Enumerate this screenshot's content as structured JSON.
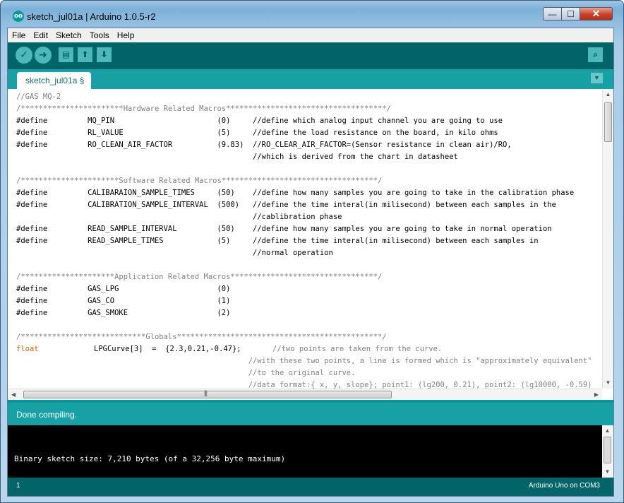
{
  "window": {
    "title": "sketch_jul01a | Arduino 1.0.5-r2",
    "controls": {
      "minimize": "—",
      "maximize": "☐",
      "close": "✕"
    },
    "icon_glyph": "oo"
  },
  "menu": [
    "File",
    "Edit",
    "Sketch",
    "Tools",
    "Help"
  ],
  "toolbar": {
    "verify_icon": "✓",
    "upload_icon": "➜",
    "new_icon": "▤",
    "open_icon": "⬆",
    "save_icon": "⬇",
    "serial_monitor_icon": "⌕"
  },
  "tabs": {
    "active": "sketch_jul01a §",
    "menu_icon": "▼"
  },
  "code_lines": [
    {
      "text": "//GAS MQ-2",
      "cls": "c-comment"
    },
    {
      "text": "/***********************Hardware Related Macros************************************/",
      "cls": "c-comment"
    },
    {
      "text": "#define         MQ_PIN                       (0)     //define which analog input channel you are going to use",
      "cls": "c-code"
    },
    {
      "text": "#define         RL_VALUE                     (5)     //define the load resistance on the board, in kilo ohms",
      "cls": "c-code"
    },
    {
      "text": "#define         RO_CLEAN_AIR_FACTOR          (9.83)  //RO_CLEAR_AIR_FACTOR=(Sensor resistance in clean air)/RO,",
      "cls": "c-code"
    },
    {
      "text": "                                                     //which is derived from the chart in datasheet",
      "cls": "c-code"
    },
    {
      "text": "",
      "cls": "c-code"
    },
    {
      "text": "/**********************Software Related Macros***********************************/",
      "cls": "c-comment"
    },
    {
      "text": "#define         CALIBARAION_SAMPLE_TIMES     (50)    //define how many samples you are going to take in the calibration phase",
      "cls": "c-code"
    },
    {
      "text": "#define         CALIBRATION_SAMPLE_INTERVAL  (500)   //define the time interal(in milisecond) between each samples in the",
      "cls": "c-code"
    },
    {
      "text": "                                                     //cablibration phase",
      "cls": "c-code"
    },
    {
      "text": "#define         READ_SAMPLE_INTERVAL         (50)    //define how many samples you are going to take in normal operation",
      "cls": "c-code"
    },
    {
      "text": "#define         READ_SAMPLE_TIMES            (5)     //define the time interal(in milisecond) between each samples in",
      "cls": "c-code"
    },
    {
      "text": "                                                     //normal operation",
      "cls": "c-code"
    },
    {
      "text": "",
      "cls": "c-code"
    },
    {
      "text": "/*********************Application Related Macros*********************************/",
      "cls": "c-comment"
    },
    {
      "text": "#define         GAS_LPG                      (0)",
      "cls": "c-code"
    },
    {
      "text": "#define         GAS_CO                       (1)",
      "cls": "c-code"
    },
    {
      "text": "#define         GAS_SMOKE                    (2)",
      "cls": "c-code"
    },
    {
      "text": "",
      "cls": "c-code"
    },
    {
      "text": "/****************************Globals**********************************************/",
      "cls": "c-comment"
    },
    {
      "text": "float",
      "cls": "c-keyword"
    },
    {
      "text": "                                                    //with these two points, a line is formed which is \"approximately equivalent\"",
      "cls": "c-comment"
    },
    {
      "text": "                                                    //to the original curve.",
      "cls": "c-comment"
    },
    {
      "text": "                                                    //data format:{ x, y, slope}; point1: (lg200, 0.21), point2: (lg10000, -0.59)",
      "cls": "c-comment"
    }
  ],
  "float_line_rest": "LPGCurve[3]  =  {2.3,0.21,-0.47};",
  "float_line_comment": "//two points are taken from the curve.",
  "scroll": {
    "up": "▲",
    "down": "▼",
    "left": "◀",
    "right": "▶",
    "grip": "|||"
  },
  "status": {
    "message": "Done compiling."
  },
  "console": {
    "output": "Binary sketch size: 7,210 bytes (of a 32,256 byte maximum)"
  },
  "footer": {
    "line": "1",
    "board": "Arduino Uno on COM3"
  }
}
